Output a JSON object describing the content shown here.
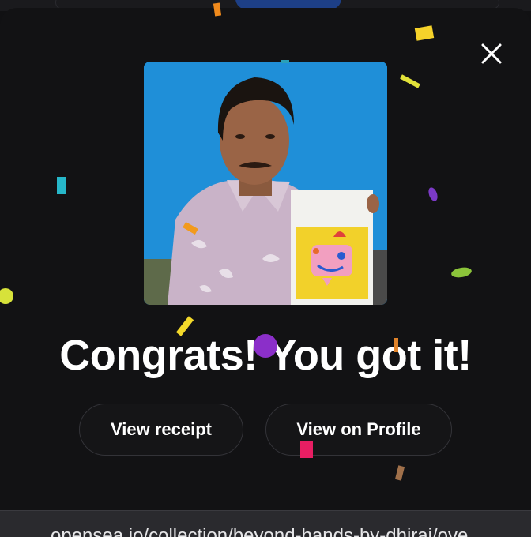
{
  "modal": {
    "title": "Congrats! You got it!",
    "close_icon": "close-icon",
    "image_alt": "Man holding a yellow drawing of a pink character"
  },
  "actions": {
    "view_receipt": "View receipt",
    "view_profile": "View on Profile"
  },
  "browser": {
    "url": "opensea.io/collection/beyond-hands-by-dhiraj/ove"
  },
  "colors": {
    "background": "#121214",
    "hero_background": "#1f8fd8",
    "button_border": "#333338",
    "text": "#ffffff"
  }
}
